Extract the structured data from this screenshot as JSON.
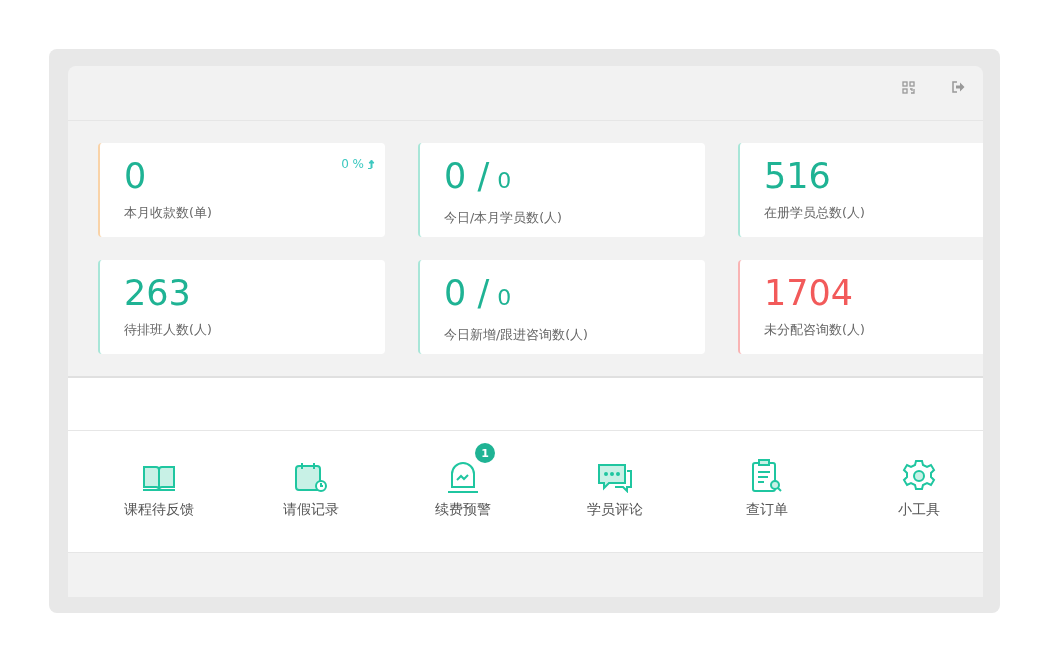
{
  "header": {
    "icons": [
      {
        "kind": "qr-code"
      },
      {
        "kind": "logout"
      }
    ]
  },
  "stats": [
    {
      "value": "0",
      "trend": "0 %",
      "label": "本月收款数(单)",
      "color": "#f9d3a8",
      "kind": "normal"
    },
    {
      "value": "0 /",
      "sub_value": "0",
      "label": "今日/本月学员数(人)",
      "color": "#a8e6d8",
      "kind": "normal"
    },
    {
      "value": "516",
      "label": "在册学员总数(人)",
      "color": "#a8e6d8",
      "kind": "normal"
    },
    {
      "value": "263",
      "label": "待排班人数(人)",
      "color": "#a8e6d8",
      "kind": "normal"
    },
    {
      "value": "0 /",
      "sub_value": "0",
      "label": "今日新增/跟进咨询数(人)",
      "color": "#a8e6d8",
      "kind": "normal"
    },
    {
      "value": "1704",
      "label": "未分配咨询数(人)",
      "color": "#f9b4b4",
      "kind": "alert"
    }
  ],
  "tools": [
    {
      "kind": "book",
      "label": "课程待反馈"
    },
    {
      "kind": "calendar",
      "label": "请假记录"
    },
    {
      "kind": "alarm",
      "label": "续费预警",
      "badge": "1"
    },
    {
      "kind": "chat",
      "label": "学员评论"
    },
    {
      "kind": "clipboard",
      "label": "查订单"
    },
    {
      "kind": "gear",
      "label": "小工具"
    }
  ]
}
